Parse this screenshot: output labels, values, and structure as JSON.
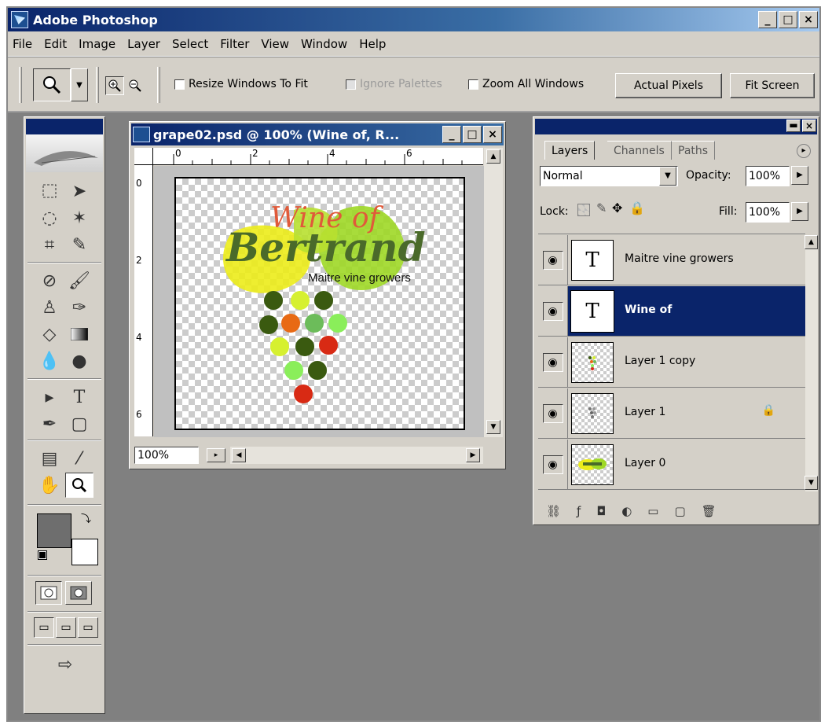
{
  "window": {
    "title": "Adobe Photoshop",
    "min": "_",
    "max": "□",
    "close": "×"
  },
  "menu": [
    "File",
    "Edit",
    "Image",
    "Layer",
    "Select",
    "Filter",
    "View",
    "Window",
    "Help"
  ],
  "options": {
    "resize_windows": "Resize Windows To Fit",
    "ignore_palettes": "Ignore Palettes",
    "zoom_all": "Zoom All Windows",
    "actual_pixels": "Actual Pixels",
    "fit_screen": "Fit Screen"
  },
  "document": {
    "title": "grape02.psd @ 100% (Wine of, R...",
    "zoom": "100%",
    "ruler_h": [
      "0",
      "2",
      "4",
      "6"
    ],
    "ruler_v": [
      "0",
      "2",
      "4",
      "6"
    ],
    "art": {
      "line1": "Wine of",
      "line2": "Bertrand",
      "tagline": "Maitre vine growers"
    }
  },
  "layers_panel": {
    "tabs": [
      "Layers",
      "Channels",
      "Paths"
    ],
    "blend_mode": "Normal",
    "opacity_label": "Opacity:",
    "opacity": "100%",
    "lock_label": "Lock:",
    "fill_label": "Fill:",
    "fill": "100%",
    "layers": [
      {
        "name": "Maitre vine growers",
        "thumb": "T"
      },
      {
        "name": "Wine of",
        "thumb": "T"
      },
      {
        "name": "Layer 1 copy",
        "thumb": ""
      },
      {
        "name": "Layer 1",
        "thumb": ""
      },
      {
        "name": "Layer 0",
        "thumb": ""
      }
    ]
  }
}
